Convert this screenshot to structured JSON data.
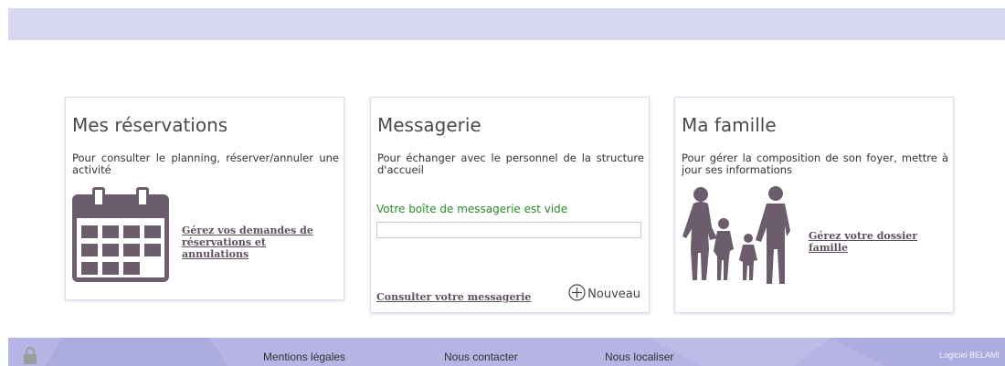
{
  "cards": {
    "reservations": {
      "title": "Mes réservations",
      "description": "Pour consulter le planning, réserver/annuler une activité",
      "link": "Gérez vos demandes de réservations et annulations",
      "icon": "calendar-icon"
    },
    "messaging": {
      "title": "Messagerie",
      "description": "Pour échanger avec le personnel de la structure d'accueil",
      "status": "Votre boîte de messagerie est vide",
      "link": "Consulter votre messagerie",
      "new_label": "Nouveau",
      "new_icon": "plus-circle-icon"
    },
    "family": {
      "title": "Ma famille",
      "description": "Pour gérer la composition de son foyer, mettre à jour ses informations",
      "link": "Gérez votre dossier famille",
      "icon": "family-icon"
    }
  },
  "footer": {
    "lock_icon": "lock-icon",
    "links": [
      "Mentions légales",
      "Nous contacter",
      "Nous localiser"
    ],
    "brand": "Logiciel BELAMI"
  },
  "colors": {
    "header_band": "#d7d7f2",
    "footer_band": "#b5b4e4",
    "icon_color": "#6c5d6c",
    "status_green": "#2a8a2a"
  }
}
